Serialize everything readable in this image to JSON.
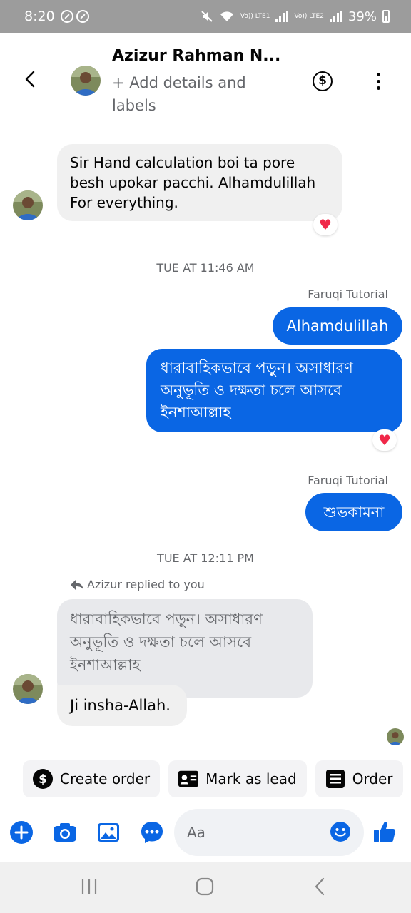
{
  "status_bar": {
    "time": "8:20",
    "battery": "39%",
    "signal_1": "Vo)) LTE1",
    "signal_2": "Vo)) LTE2"
  },
  "header": {
    "contact_name": "Azizur Rahman N...",
    "details_link": "+ Add details and labels"
  },
  "messages": [
    {
      "type": "incoming",
      "text": "Sir Hand calculation boi ta pore besh upokar pacchi. Alhamdulillah For everything.",
      "reaction": "heart"
    },
    {
      "type": "timestamp",
      "text": "TUE AT 11:46 AM"
    },
    {
      "type": "sender",
      "text": "Faruqi Tutorial"
    },
    {
      "type": "outgoing",
      "text": "Alhamdulillah"
    },
    {
      "type": "outgoing",
      "text": "ধারাবাহিকভাবে পড়ুন। অসাধারণ অনুভূতি ও দক্ষতা চলে আসবে ইনশাআল্লাহ",
      "reaction": "heart"
    },
    {
      "type": "sender",
      "text": "Faruqi Tutorial"
    },
    {
      "type": "outgoing",
      "text": "শুভকামনা"
    },
    {
      "type": "timestamp",
      "text": "TUE AT 12:11 PM"
    },
    {
      "type": "reply_note",
      "text": "Azizur replied to you"
    },
    {
      "type": "incoming_quote",
      "quote": "ধারাবাহিকভাবে পড়ুন। অসাধারণ অনুভূতি ও দক্ষতা চলে আসবে ইনশাআল্লাহ",
      "text": "Ji insha-Allah."
    }
  ],
  "quick_actions": [
    {
      "label": "Create order",
      "icon": "dollar-icon"
    },
    {
      "label": "Mark as lead",
      "icon": "contact-card-icon"
    },
    {
      "label": "Order",
      "icon": "list-icon"
    }
  ],
  "composer": {
    "placeholder": "Aa"
  },
  "colors": {
    "accent": "#0a66e4",
    "incoming_bubble": "#f0f0f0",
    "heart": "#f02849",
    "status_bar": "#9c9c9c"
  }
}
